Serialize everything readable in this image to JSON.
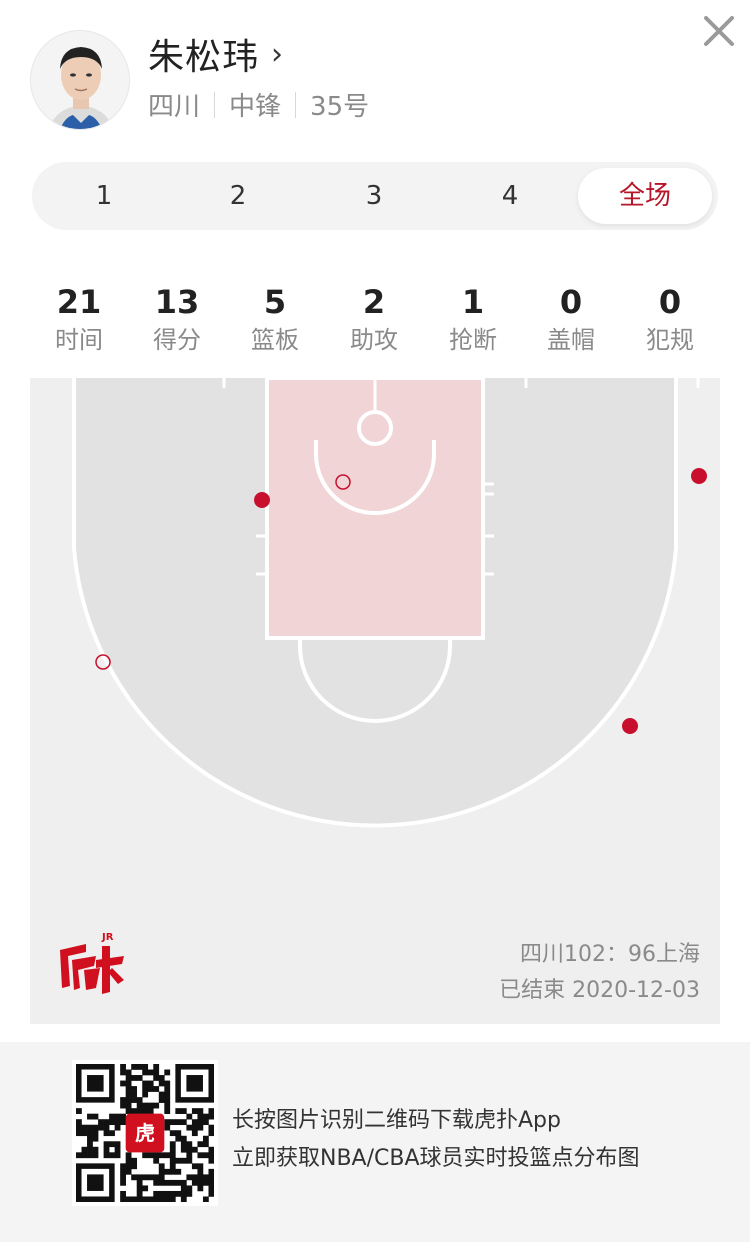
{
  "player": {
    "name": "朱松玮",
    "team": "四川",
    "position": "中锋",
    "number": "35号"
  },
  "icons": {
    "avatar": "player-avatar",
    "chevron": "chevron-right-icon",
    "close": "close-icon",
    "logo": "hupu-logo",
    "qr": "qr-code"
  },
  "tabs": [
    {
      "label": "1",
      "active": false
    },
    {
      "label": "2",
      "active": false
    },
    {
      "label": "3",
      "active": false
    },
    {
      "label": "4",
      "active": false
    },
    {
      "label": "全场",
      "active": true
    }
  ],
  "stats": [
    {
      "value": "21",
      "label": "时间"
    },
    {
      "value": "13",
      "label": "得分"
    },
    {
      "value": "5",
      "label": "篮板"
    },
    {
      "value": "2",
      "label": "助攻"
    },
    {
      "value": "1",
      "label": "抢断"
    },
    {
      "value": "0",
      "label": "盖帽"
    },
    {
      "value": "0",
      "label": "犯规"
    }
  ],
  "shot_chart": {
    "made_color": "#c8102e",
    "missed_color": "#c8102e",
    "shots": [
      {
        "result": "made"
      },
      {
        "result": "missed"
      },
      {
        "result": "made"
      },
      {
        "result": "missed"
      },
      {
        "result": "made"
      }
    ]
  },
  "game": {
    "score": "四川102：96上海",
    "status": "已结束 2020-12-03"
  },
  "footer": {
    "line1": "长按图片识别二维码下载虎扑App",
    "line2": "立即获取NBA/CBA球员实时投篮点分布图"
  },
  "colors": {
    "accent": "#b5172b",
    "paint": "#f0d4d6",
    "court_shade": "#e2e2e2",
    "court_bg": "#efefef"
  }
}
